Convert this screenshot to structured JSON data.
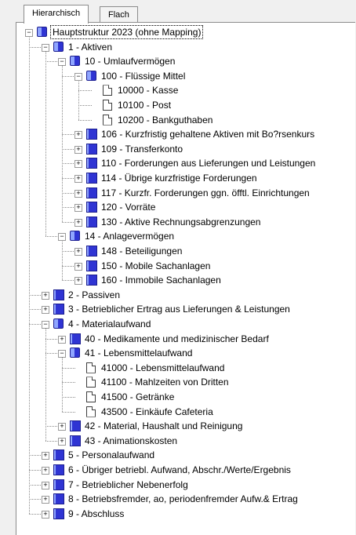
{
  "tabs": [
    "Hierarchisch",
    "Flach"
  ],
  "tree": [
    {
      "label": "Hauptstruktur 2023 (ohne Mapping)",
      "level": 0,
      "icon": "book-open-icon",
      "expanded": true,
      "selected": true
    },
    {
      "label": "1 - Aktiven",
      "level": 1,
      "icon": "book-open-icon",
      "expanded": true
    },
    {
      "label": "10 - Umlaufvermögen",
      "level": 2,
      "icon": "book-open-icon",
      "expanded": true
    },
    {
      "label": "100 - Flüssige Mittel",
      "level": 3,
      "icon": "book-open-icon",
      "expanded": true
    },
    {
      "label": "10000 - Kasse",
      "level": 4,
      "icon": "document-icon"
    },
    {
      "label": "10100 - Post",
      "level": 4,
      "icon": "document-icon"
    },
    {
      "label": "10200 - Bankguthaben",
      "level": 4,
      "icon": "document-icon"
    },
    {
      "label": "106 - Kurzfristig gehaltene Aktiven mit Bo?rsenkurs",
      "level": 3,
      "icon": "book-icon",
      "expanded": false
    },
    {
      "label": "109 - Transferkonto",
      "level": 3,
      "icon": "book-icon",
      "expanded": false
    },
    {
      "label": "110 - Forderungen aus Lieferungen und Leistungen",
      "level": 3,
      "icon": "book-icon",
      "expanded": false
    },
    {
      "label": "114 - Übrige kurzfristige Forderungen",
      "level": 3,
      "icon": "book-icon",
      "expanded": false
    },
    {
      "label": "117 - Kurzfr. Forderungen ggn. öfftl. Einrichtungen",
      "level": 3,
      "icon": "book-icon",
      "expanded": false
    },
    {
      "label": "120 - Vorräte",
      "level": 3,
      "icon": "book-icon",
      "expanded": false
    },
    {
      "label": "130 - Aktive Rechnungsabgrenzungen",
      "level": 3,
      "icon": "book-icon",
      "expanded": false
    },
    {
      "label": "14 - Anlagevermögen",
      "level": 2,
      "icon": "book-open-icon",
      "expanded": true
    },
    {
      "label": "148 - Beteiligungen",
      "level": 3,
      "icon": "book-icon",
      "expanded": false
    },
    {
      "label": "150 - Mobile Sachanlagen",
      "level": 3,
      "icon": "book-icon",
      "expanded": false
    },
    {
      "label": "160 - Immobile Sachanlagen",
      "level": 3,
      "icon": "book-icon",
      "expanded": false
    },
    {
      "label": "2 - Passiven",
      "level": 1,
      "icon": "book-icon",
      "expanded": false
    },
    {
      "label": "3 - Betrieblicher Ertrag aus Lieferungen & Leistungen",
      "level": 1,
      "icon": "book-icon",
      "expanded": false
    },
    {
      "label": "4 - Materialaufwand",
      "level": 1,
      "icon": "book-open-icon",
      "expanded": true
    },
    {
      "label": "40 - Medikamente und medizinischer Bedarf",
      "level": 2,
      "icon": "book-icon",
      "expanded": false
    },
    {
      "label": "41 - Lebensmittelaufwand",
      "level": 2,
      "icon": "book-open-icon",
      "expanded": true
    },
    {
      "label": "41000 - Lebensmittelaufwand",
      "level": 3,
      "icon": "document-icon"
    },
    {
      "label": "41100 - Mahlzeiten von Dritten",
      "level": 3,
      "icon": "document-icon"
    },
    {
      "label": "41500 - Getränke",
      "level": 3,
      "icon": "document-icon"
    },
    {
      "label": "43500 - Einkäufe Cafeteria",
      "level": 3,
      "icon": "document-icon"
    },
    {
      "label": "42 - Material, Haushalt und Reinigung",
      "level": 2,
      "icon": "book-icon",
      "expanded": false
    },
    {
      "label": "43 - Animationskosten",
      "level": 2,
      "icon": "book-icon",
      "expanded": false
    },
    {
      "label": "5 - Personalaufwand",
      "level": 1,
      "icon": "book-icon",
      "expanded": false
    },
    {
      "label": "6 - Übriger betriebl. Aufwand, Abschr./Werte/Ergebnis",
      "level": 1,
      "icon": "book-icon",
      "expanded": false
    },
    {
      "label": "7 - Betrieblicher Nebenerfolg",
      "level": 1,
      "icon": "book-icon",
      "expanded": false
    },
    {
      "label": "8 - Betriebsfremder, ao, periodenfremder Aufw.& Ertrag",
      "level": 1,
      "icon": "book-icon",
      "expanded": false
    },
    {
      "label": "9 - Abschluss",
      "level": 1,
      "icon": "book-icon",
      "expanded": false
    }
  ]
}
